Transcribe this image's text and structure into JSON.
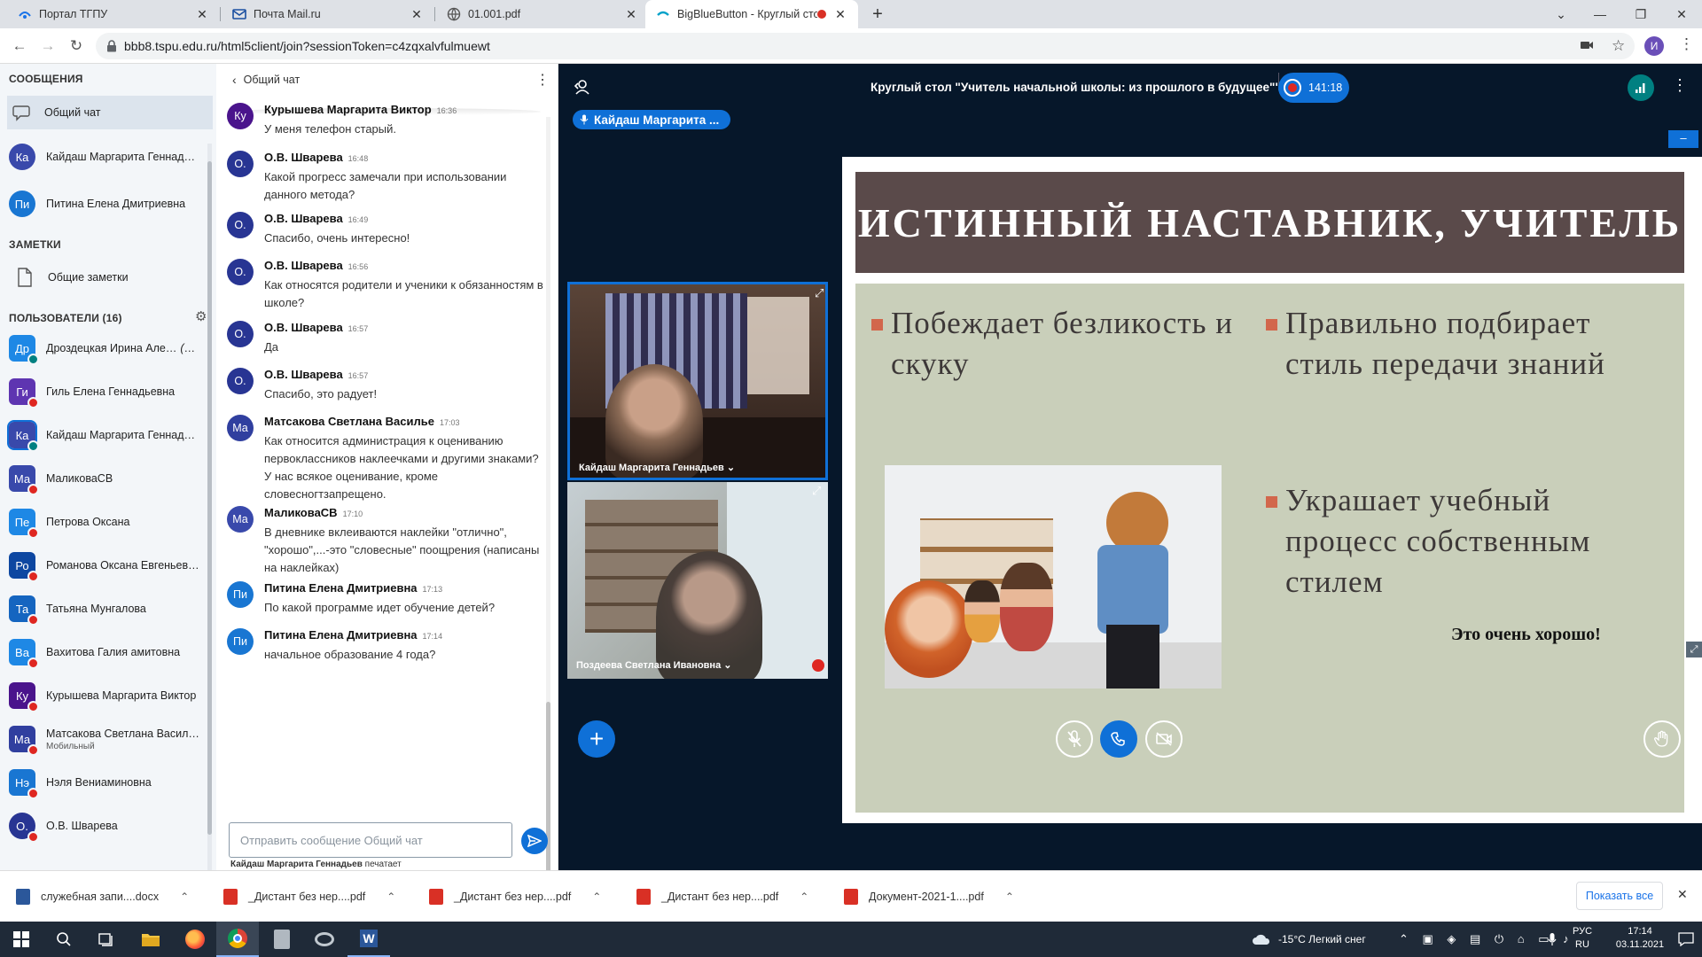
{
  "browser": {
    "tabs": [
      {
        "title": "Портал ТГПУ",
        "icon": "portal-icon"
      },
      {
        "title": "Почта Mail.ru",
        "icon": "mail-icon"
      },
      {
        "title": "01.001.pdf",
        "icon": "globe-icon"
      },
      {
        "title": "BigBlueButton - Круглый сто",
        "icon": "bbb-icon"
      }
    ],
    "address": "bbb8.tspu.edu.ru/html5client/join?sessionToken=c4zqxalvfulmuewt",
    "profile_initial": "И"
  },
  "sidebar": {
    "messages_header": "СООБЩЕНИЯ",
    "public_chat": "Общий чат",
    "private_chats": [
      {
        "initials": "Ка",
        "name": "Кайдаш Маргарита Геннадьев",
        "color": "#3949ab"
      },
      {
        "initials": "Пи",
        "name": "Питина Елена Дмитриевна",
        "color": "#1976d2"
      }
    ],
    "notes_header": "ЗАМЕТКИ",
    "shared_notes": "Общие заметки",
    "users_header": "ПОЛЬЗОВАТЕЛИ (16)",
    "users": [
      {
        "initials": "Др",
        "name": "Дроздецкая Ирина Але…",
        "you": "(Вы)",
        "color": "#1e88e5",
        "sub": ""
      },
      {
        "initials": "Ги",
        "name": "Гиль Елена Геннадьевна",
        "you": "",
        "color": "#5e35b1",
        "sub": ""
      },
      {
        "initials": "Ка",
        "name": "Кайдаш Маргарита Геннадь…",
        "you": "",
        "color": "#3949ab",
        "sub": ""
      },
      {
        "initials": "Ма",
        "name": "МаликоваСВ",
        "you": "",
        "color": "#3949ab",
        "sub": ""
      },
      {
        "initials": "Пе",
        "name": "Петрова Оксана",
        "you": "",
        "color": "#1e88e5",
        "sub": ""
      },
      {
        "initials": "Ро",
        "name": "Романова Оксана Евгеньев…",
        "you": "",
        "color": "#0d47a1",
        "sub": ""
      },
      {
        "initials": "Та",
        "name": "Татьяна Мунгалова",
        "you": "",
        "color": "#1565c0",
        "sub": ""
      },
      {
        "initials": "Ва",
        "name": "Вахитова Галия амитовна",
        "you": "",
        "color": "#1e88e5",
        "sub": ""
      },
      {
        "initials": "Ку",
        "name": "Курышева Маргарита Виктор",
        "you": "",
        "color": "#4a148c",
        "sub": ""
      },
      {
        "initials": "Ма",
        "name": "Матсакова Светлана Васил…",
        "you": "",
        "color": "#303f9f",
        "sub": "Мобильный"
      },
      {
        "initials": "Нэ",
        "name": "Нэля Вениаминовна",
        "you": "",
        "color": "#1976d2",
        "sub": ""
      },
      {
        "initials": "О.",
        "name": "О.В. Шварева",
        "you": "",
        "color": "#283593",
        "sub": ""
      }
    ]
  },
  "chat": {
    "title": "Общий чат",
    "messages": [
      {
        "initials": "Ку",
        "color": "#4a148c",
        "author": "Курышева Маргарита Виктор",
        "time": "16:36",
        "text": "У меня телефон старый."
      },
      {
        "initials": "О.",
        "color": "#283593",
        "author": "О.В. Шварева",
        "time": "16:48",
        "text": "Какой прогресс замечали при использовании данного метода?"
      },
      {
        "initials": "О.",
        "color": "#283593",
        "author": "О.В. Шварева",
        "time": "16:49",
        "text": "Спасибо, очень интересно!"
      },
      {
        "initials": "О.",
        "color": "#283593",
        "author": "О.В. Шварева",
        "time": "16:56",
        "text": "Как относятся родители и ученики к обязанностям в школе?"
      },
      {
        "initials": "О.",
        "color": "#283593",
        "author": "О.В. Шварева",
        "time": "16:57",
        "text": "Да"
      },
      {
        "initials": "О.",
        "color": "#283593",
        "author": "О.В. Шварева",
        "time": "16:57",
        "text": "Спасибо, это радует!"
      },
      {
        "initials": "Ма",
        "color": "#303f9f",
        "author": "Матсакова Светлана Василье",
        "time": "17:03",
        "text": "Как относится администрация к оцениванию первоклассников наклеечками и другими знаками? У нас всякое оценивание, кроме словесногтзапрещено."
      },
      {
        "initials": "Ма",
        "color": "#3949ab",
        "author": "МаликоваСВ",
        "time": "17:10",
        "text": "В дневнике вклеиваются наклейки \"отлично\", \"хорошо\",...-это \"словесные\" поощрения (написаны на наклейках)"
      },
      {
        "initials": "Пи",
        "color": "#1976d2",
        "author": "Питина Елена Дмитриевна",
        "time": "17:13",
        "text": "По какой программе идет обучение детей?"
      },
      {
        "initials": "Пи",
        "color": "#1976d2",
        "author": "Питина Елена Дмитриевна",
        "time": "17:14",
        "text": "начальное образование 4 года?"
      }
    ],
    "input_placeholder": "Отправить сообщение Общий чат",
    "typing": "Кайдаш Маргарита Геннадьев",
    "typing_suffix": "печатает"
  },
  "meeting": {
    "title": "Круглый стол \"Учитель начальной школы: из прошлого в будущее\"\"",
    "recording_time": "141:18",
    "presenter_badge": "Кайдаш Маргарита ...",
    "videos": [
      {
        "name": "Кайдаш Маргарита Геннадьев"
      },
      {
        "name": "Поздеева Светлана Ивановна"
      }
    ]
  },
  "slide": {
    "title": "ИСТИННЫЙ НАСТАВНИК, УЧИТЕЛЬ",
    "bullet1": "Побеждает безликость и скуку",
    "bullet2": "Правильно подбирает стиль передачи знаний",
    "bullet3": "Украшает учебный процесс собственным стилем",
    "footer": "Это очень хорошо!"
  },
  "downloads": {
    "items": [
      {
        "name": "служебная запи....docx",
        "type": "docx"
      },
      {
        "name": "_Дистант без нер....pdf",
        "type": "pdf"
      },
      {
        "name": "_Дистант без нер....pdf",
        "type": "pdf"
      },
      {
        "name": "_Дистант без нер....pdf",
        "type": "pdf"
      },
      {
        "name": "Документ-2021-1....pdf",
        "type": "pdf"
      }
    ],
    "show_all": "Показать все"
  },
  "taskbar": {
    "weather": "-15°C  Легкий снег",
    "lang": "РУС",
    "lang_sub": "RU",
    "time": "17:14",
    "date": "03.11.2021"
  },
  "colors": {
    "bbb_dark": "#06172a",
    "bbb_blue": "#0f70d7",
    "mute_red": "#df2721",
    "slide_title_bg": "#5a4a4a",
    "slide_body_bg": "#c9cfba"
  }
}
